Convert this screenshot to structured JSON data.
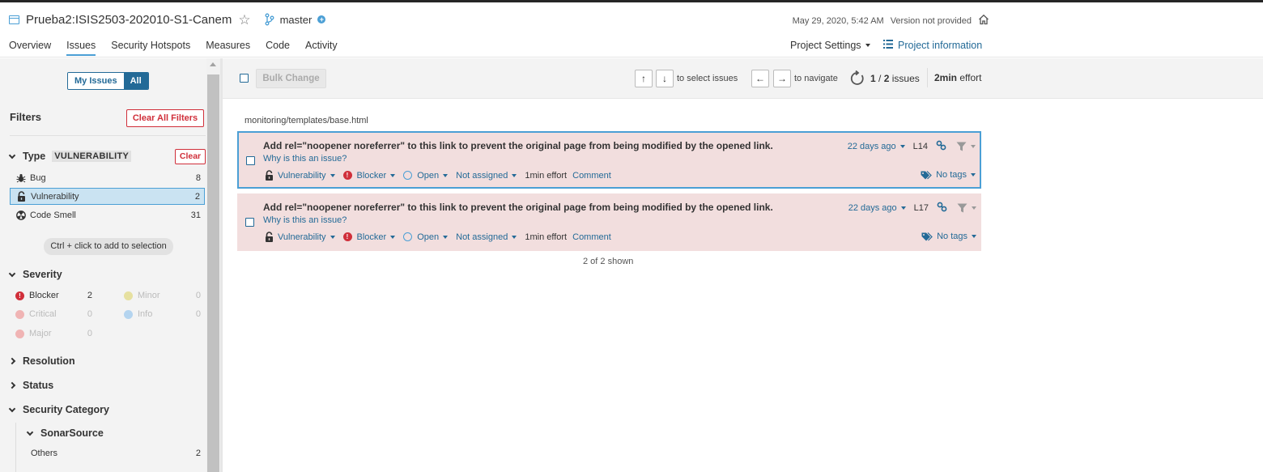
{
  "header": {
    "project_title": "Prueba2:ISIS2503-202010-S1-Canem",
    "branch": "master",
    "date": "May 29, 2020, 5:42 AM",
    "version": "Version not provided",
    "tabs": [
      {
        "label": "Overview"
      },
      {
        "label": "Issues"
      },
      {
        "label": "Security Hotspots"
      },
      {
        "label": "Measures"
      },
      {
        "label": "Code"
      },
      {
        "label": "Activity"
      }
    ],
    "project_settings": "Project Settings",
    "project_information": "Project information"
  },
  "sidebar": {
    "toggle_my_issues": "My Issues",
    "toggle_all": "All",
    "filters_title": "Filters",
    "clear_all": "Clear All Filters",
    "type": {
      "title": "Type",
      "badge": "VULNERABILITY",
      "clear": "Clear",
      "items": [
        {
          "label": "Bug",
          "count": "8",
          "icon": "bug-icon"
        },
        {
          "label": "Vulnerability",
          "count": "2",
          "icon": "lock-icon"
        },
        {
          "label": "Code Smell",
          "count": "31",
          "icon": "code-smell-icon"
        }
      ]
    },
    "hint": "Ctrl + click to add to selection",
    "severity": {
      "title": "Severity",
      "items": [
        {
          "label": "Blocker",
          "count": "2"
        },
        {
          "label": "Minor",
          "count": "0"
        },
        {
          "label": "Critical",
          "count": "0"
        },
        {
          "label": "Info",
          "count": "0"
        },
        {
          "label": "Major",
          "count": "0"
        }
      ]
    },
    "resolution": "Resolution",
    "status": "Status",
    "security_category": "Security Category",
    "sonarsource": "SonarSource",
    "others_label": "Others",
    "others_count": "2"
  },
  "toolbar": {
    "bulk_change": "Bulk Change",
    "up_key": "↑",
    "down_key": "↓",
    "select_text": "to select issues",
    "left_key": "←",
    "right_key": "→",
    "navigate_text": "to navigate",
    "current": "1",
    "slash": " / ",
    "total": "2",
    "issues_word": " issues",
    "effort_value": "2min",
    "effort_word": " effort"
  },
  "file_path": "monitoring/templates/base.html",
  "issues": [
    {
      "message": "Add rel=\"noopener noreferrer\" to this link to prevent the original page from being modified by the opened link.",
      "why": "Why is this an issue?",
      "type": "Vulnerability",
      "severity": "Blocker",
      "status": "Open",
      "assignee": "Not assigned",
      "effort": "1min effort",
      "comment": "Comment",
      "age": "22 days ago",
      "line": "L14",
      "tags": "No tags"
    },
    {
      "message": "Add rel=\"noopener noreferrer\" to this link to prevent the original page from being modified by the opened link.",
      "why": "Why is this an issue?",
      "type": "Vulnerability",
      "severity": "Blocker",
      "status": "Open",
      "assignee": "Not assigned",
      "effort": "1min effort",
      "comment": "Comment",
      "age": "22 days ago",
      "line": "L17",
      "tags": "No tags"
    }
  ],
  "shown_text": "2 of 2 shown",
  "colors": {
    "accent": "#4b9fd5",
    "link": "#236a97",
    "danger": "#d02f3a",
    "issue_bg": "#f2dede",
    "selected_facet": "#cae3f2"
  }
}
